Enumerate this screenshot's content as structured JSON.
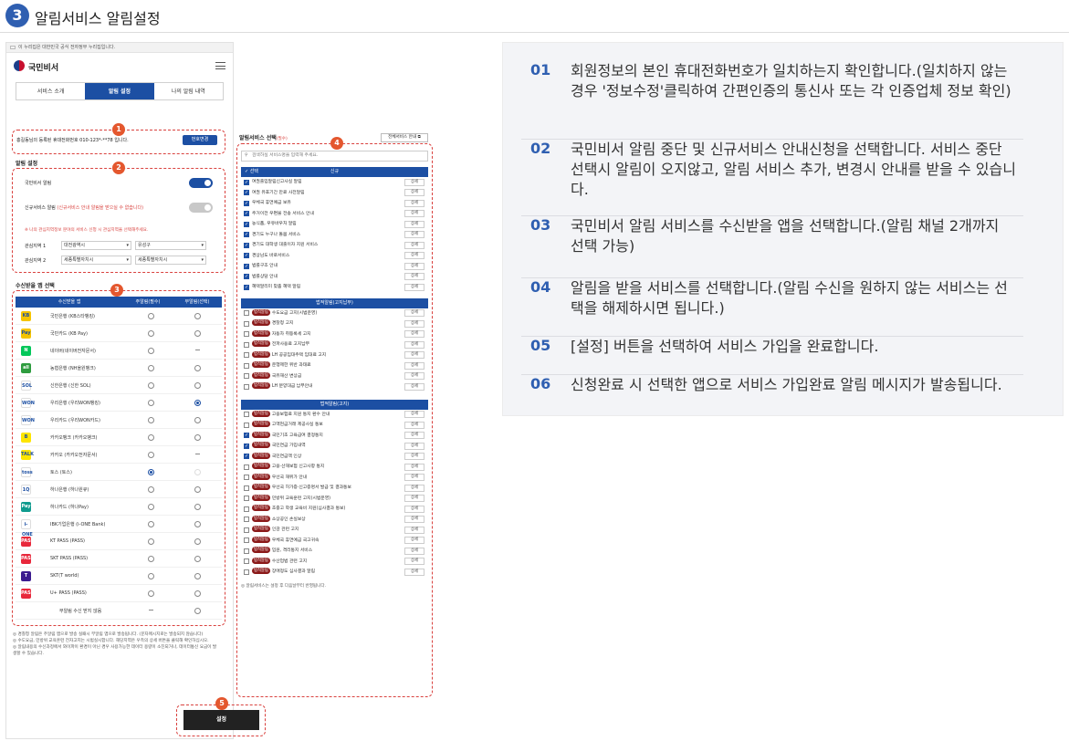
{
  "section": {
    "number": "3",
    "title": "알림서비스 알림설정"
  },
  "phone": {
    "notice": "이 누리집은 대한민국 공식 전자정부 누리집입니다.",
    "app_name": "국민비서",
    "tabs": [
      "서비스 소개",
      "알림 설정",
      "나의 알림 내역"
    ],
    "phone_text": "홍길동님의 등록된 휴대전화번호 010-123*-**78 입니다.",
    "phone_change_button": "번호변경",
    "alert_settings_title": "알림 설정",
    "toggle1_label": "국민비서 알림",
    "toggle2_label": "신규서비스 알림",
    "toggle2_note": "(신규서비스 안내 알림을 받으실 수 없습니다)",
    "region_note": "※ 나의 관심지역정보 분야의 서비스 신청 시 관심지역을 선택해주세요.",
    "region1_label": "관심지역 1",
    "region1_values": [
      "대전광역시",
      "유성구"
    ],
    "region2_label": "관심지역 2",
    "region2_values": [
      "세종특별자치시",
      "세종특별자치시"
    ],
    "apps_title": "수신받을 앱 선택",
    "apps_headers": [
      "수신받을 앱",
      "주알림(필수)",
      "부알림(선택)"
    ],
    "apps": [
      {
        "name": "국민은행 (KB스타뱅킹)",
        "color": "#f5c400",
        "icon": "KB",
        "main": "off",
        "sub": "off"
      },
      {
        "name": "국민카드 (KB Pay)",
        "color": "#f5c400",
        "icon": "Pay",
        "main": "off",
        "sub": "off"
      },
      {
        "name": "네이버(네이버전자문서)",
        "color": "#03c75a",
        "icon": "N",
        "main": "off",
        "sub": "none"
      },
      {
        "name": "농협은행 (NH올원뱅크)",
        "color": "#2e9c3f",
        "icon": "all",
        "main": "off",
        "sub": "off"
      },
      {
        "name": "신한은행 (신한 SOL)",
        "color": "#ffffff",
        "icon": "SOL",
        "main": "off",
        "sub": "off"
      },
      {
        "name": "우리은행 (우리WON뱅킹)",
        "color": "#ffffff",
        "icon": "WON",
        "main": "off",
        "sub": "on"
      },
      {
        "name": "우리카드 (우리WON카드)",
        "color": "#ffffff",
        "icon": "WON",
        "main": "off",
        "sub": "off"
      },
      {
        "name": "카카오뱅크 (카카오뱅크)",
        "color": "#fee500",
        "icon": "B",
        "main": "off",
        "sub": "off"
      },
      {
        "name": "카카오 (카카오전자문서)",
        "color": "#fee500",
        "icon": "TALK",
        "main": "off",
        "sub": "none"
      },
      {
        "name": "토스 (토스)",
        "color": "#ffffff",
        "icon": "toss",
        "main": "on",
        "sub": "dis"
      },
      {
        "name": "하나은행 (하나원큐)",
        "color": "#ffffff",
        "icon": "1Q",
        "main": "off",
        "sub": "off"
      },
      {
        "name": "하나카드 (하나Pay)",
        "color": "#0f9b8e",
        "icon": "Pay",
        "main": "off",
        "sub": "off"
      },
      {
        "name": "IBK기업은행 (i-ONE Bank)",
        "color": "#ffffff",
        "icon": "i-ONE",
        "main": "off",
        "sub": "off"
      },
      {
        "name": "KT PASS (PASS)",
        "color": "#e8283b",
        "icon": "PASS",
        "main": "off",
        "sub": "off"
      },
      {
        "name": "SKT PASS (PASS)",
        "color": "#e8283b",
        "icon": "PASS",
        "main": "off",
        "sub": "off"
      },
      {
        "name": "SKT(T world)",
        "color": "#3b1b8f",
        "icon": "T",
        "main": "off",
        "sub": "off"
      },
      {
        "name": "U+ PASS (PASS)",
        "color": "#e8283b",
        "icon": "PASS",
        "main": "off",
        "sub": "off"
      },
      {
        "name": "부알림 수신 받지 않음",
        "color": "",
        "icon": "",
        "main": "none",
        "sub": "off"
      }
    ],
    "notes": [
      "경찰청 알림은 주알림 앱으로 발송 실패시 부알림 앱으로 발송됩니다. (문자메시지로는 발송되지 않습니다)",
      "수도요금, 민방위 교육훈련 전자고지는 시범실시합니다. 해당지역은 우측의 상세 버튼을 클릭해 확인하십시오.",
      "알림내용의 수신과정에서 와이파이 환경이 아닌 경우 사용가능한 데이터 용량이 소진되거나, 데이터통신 요금이 발생할 수 있습니다."
    ],
    "set_button": "설정",
    "services_title": "알림서비스 선택",
    "services_required": "(필수)",
    "all_services_button": "전체서비스 안내",
    "search_placeholder": "검색하실 서비스명을 입력해 주세요.",
    "header_select": "선택",
    "group_new": "신규",
    "detail_label": "상세",
    "law_tag": "법적알림",
    "new_services": [
      "여권출입알림신고사실 알림",
      "여권 유효기간 만료 사전알림",
      "우체국 휴면예금 보유",
      "주거이전 우편물 전송 서비스 안내",
      "농식품, 우유바우처 알림",
      "경기도 누구나 돌봄 서비스",
      "경기도 대학생 대출이자 지원 서비스",
      "경상남도 바로서비스",
      "법률구조 안내",
      "법률상담 안내",
      "혜택알리미 맞춤 혜택 알림"
    ],
    "group_law_notice": "법적알림(고지납부)",
    "law_notice_services": [
      "수도요금 고지(시범운영)",
      "경찰청 고지",
      "자동차 취등록세 고지",
      "전파사용료 고지납부",
      "LH 공공임대주택 임대료 고지",
      "운행제한 위반 과태료",
      "국유재산 변상금",
      "LH 분양대금 납부안내"
    ],
    "group_law": "법적알림(고지)",
    "law_services": [
      {
        "label": "고용보험료 지원 통지 환수 안내",
        "checked": false
      },
      {
        "label": "고액현금거래 제공사실 통보",
        "checked": false
      },
      {
        "label": "국민기초 고육급여 결정통지",
        "checked": true
      },
      {
        "label": "국민연금 가입내역",
        "checked": true
      },
      {
        "label": "국민연금액 인상",
        "checked": true
      },
      {
        "label": "고용·산재보험 신고사항 통지",
        "checked": false
      },
      {
        "label": "우선국 재위가 안내",
        "checked": false
      },
      {
        "label": "우선국 허가증·신고증명서 발급 및 결과통보",
        "checked": false
      },
      {
        "label": "민방위 교육훈련 고지(시범운영)",
        "checked": false
      },
      {
        "label": "초중고 학생 교육비 지원(심사결과 통보)",
        "checked": false
      },
      {
        "label": "소상공인 손실보상",
        "checked": false
      },
      {
        "label": "인감 관련 고지",
        "checked": false
      },
      {
        "label": "우체국 휴면예금 국고귀속",
        "checked": false
      },
      {
        "label": "입원, 격리통지 서비스",
        "checked": false
      },
      {
        "label": "수산업법 관련 고지",
        "checked": false
      },
      {
        "label": "장애정도 심사결과 알림",
        "checked": false
      }
    ],
    "services_footnote": "알림서비스는 설정 후 다음날부터 반영됩니다.",
    "badges": [
      "1",
      "2",
      "3",
      "4",
      "5"
    ]
  },
  "steps": [
    {
      "num": "01",
      "text": "회원정보의 본인 휴대전화번호가 일치하는지 확인합니다.(일치하지 않는 경우 '정보수정'클릭하여 간편인증의 통신사 또는 각 인증업체 정보 확인)"
    },
    {
      "num": "02",
      "text": "국민비서 알림 중단 및 신규서비스 안내신청을 선택합니다. 서비스 중단 선택시 알림이 오지않고, 알림 서비스 추가, 변경시 안내를 받을 수 있습니다."
    },
    {
      "num": "03",
      "text": "국민비서 알림 서비스를 수신받을 앱을 선택합니다.(알림 채널 2개까지 선택 가능)"
    },
    {
      "num": "04",
      "text": "알림을 받을 서비스를 선택합니다.(알림 수신을 원하지 않는 서비스는 선택을 해제하시면 됩니다.)"
    },
    {
      "num": "05",
      "text": "[설정] 버튼을 선택하여 서비스 가입을 완료합니다."
    },
    {
      "num": "06",
      "text": "신청완료 시 선택한 앱으로 서비스 가입완료 알림 메시지가 발송됩니다."
    }
  ]
}
